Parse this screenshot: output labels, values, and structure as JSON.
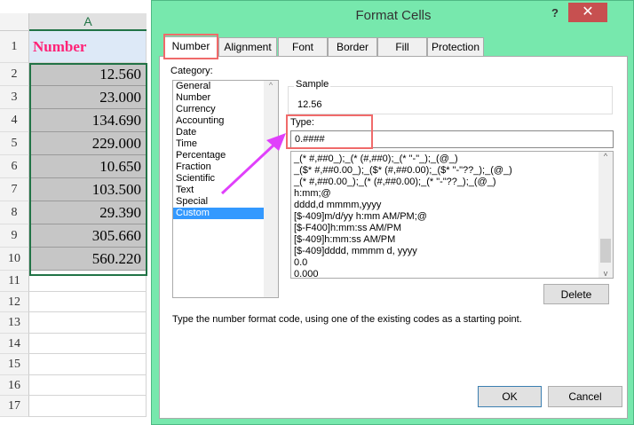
{
  "sheet": {
    "column": "A",
    "rows": [
      "1",
      "2",
      "3",
      "4",
      "5",
      "6",
      "7",
      "8",
      "9",
      "10",
      "11",
      "12",
      "13",
      "14",
      "15",
      "16",
      "17"
    ],
    "header_cell": "Number",
    "values": [
      "12.560",
      "23.000",
      "134.690",
      "229.000",
      "10.650",
      "103.500",
      "29.390",
      "305.660",
      "560.220"
    ]
  },
  "dialog": {
    "title": "Format Cells",
    "help": "?",
    "close": "✕",
    "tabs": [
      "Number",
      "Alignment",
      "Font",
      "Border",
      "Fill",
      "Protection"
    ],
    "category_label": "Category:",
    "categories": [
      "General",
      "Number",
      "Currency",
      "Accounting",
      "Date",
      "Time",
      "Percentage",
      "Fraction",
      "Scientific",
      "Text",
      "Special",
      "Custom"
    ],
    "sample_label": "Sample",
    "sample_value": "12.56",
    "type_label": "Type:",
    "type_value": "0.####",
    "formats": [
      "_(* #,##0_);_(* (#,##0);_(* \"-\"_);_(@_)",
      "_($* #,##0.00_);_($* (#,##0.00);_($* \"-\"??_);_(@_)",
      "_(* #,##0.00_);_(* (#,##0.00);_(* \"-\"??_);_(@_)",
      "h:mm;@",
      "dddd,d mmmm,yyyy",
      "[$-409]m/d/yy h:mm AM/PM;@",
      "[$-F400]h:mm:ss AM/PM",
      "[$-409]h:mm:ss AM/PM",
      "[$-409]dddd, mmmm d, yyyy",
      "0.0",
      "0.000"
    ],
    "delete": "Delete",
    "hint": "Type the number format code, using one of the existing codes as a starting point.",
    "ok": "OK",
    "cancel": "Cancel"
  },
  "colors": {
    "dialog": "#77e8ad",
    "highlight": "#f06a6a",
    "arrow": "#e040fb",
    "header_text": "#ff2277"
  }
}
